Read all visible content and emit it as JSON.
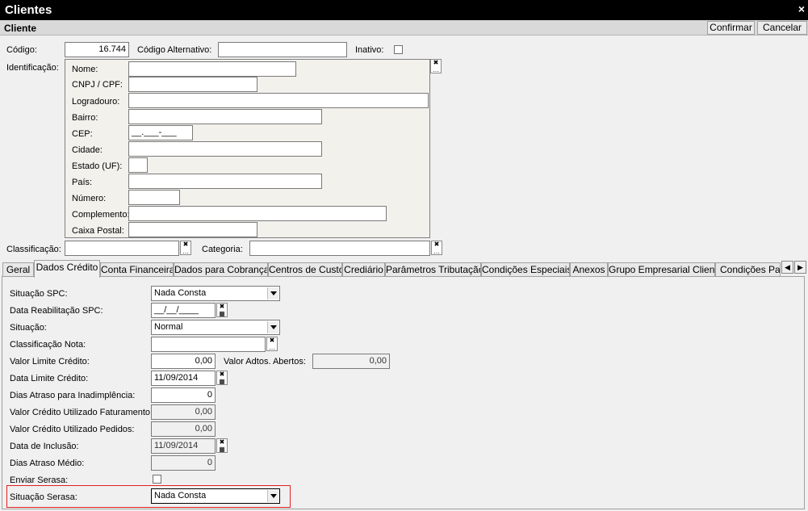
{
  "window": {
    "title": "Clientes",
    "close": "×"
  },
  "header": {
    "title": "Cliente",
    "confirm": "Confirmar",
    "cancel": "Cancelar"
  },
  "top": {
    "codigo_label": "Código:",
    "codigo_value": "16.744",
    "codigo_alt_label": "Código Alternativo:",
    "codigo_alt_value": "",
    "inativo_label": "Inativo:",
    "identificacao_label": "Identificação:"
  },
  "ident": {
    "nome": "Nome:",
    "cnpj": "CNPJ / CPF:",
    "logradouro": "Logradouro:",
    "bairro": "Bairro:",
    "cep": "CEP:",
    "cep_mask": "__.___-___",
    "cidade": "Cidade:",
    "estado": "Estado (UF):",
    "pais": "País:",
    "numero": "Número:",
    "complemento": "Complemento:",
    "caixa_postal": "Caixa Postal:"
  },
  "classificacao_label": "Classificação:",
  "categoria_label": "Categoria:",
  "tabs": [
    "Geral",
    "Dados Crédito",
    "Conta Financeira",
    "Dados para Cobrança",
    "Centros de Custo",
    "Crediário",
    "Parâmetros Tributação",
    "Condições Especiais",
    "Anexos",
    "Grupo Empresarial Cliente",
    "Condições Parc"
  ],
  "credito": {
    "situacao_spc_label": "Situação SPC:",
    "situacao_spc_value": "Nada Consta",
    "data_reab_label": "Data Reabilitação SPC:",
    "data_reab_value": "__/__/____",
    "situacao_label": "Situação:",
    "situacao_value": "Normal",
    "class_nota_label": "Classificação Nota:",
    "valor_limite_label": "Valor Limite Crédito:",
    "valor_limite_value": "0,00",
    "valor_adtos_label": "Valor Adtos. Abertos:",
    "valor_adtos_value": "0,00",
    "data_limite_label": "Data Limite Crédito:",
    "data_limite_value": "11/09/2014",
    "dias_atraso_inad_label": "Dias Atraso para Inadimplência:",
    "dias_atraso_inad_value": "0",
    "valor_fat_label": "Valor Crédito Utilizado Faturamento:",
    "valor_fat_value": "0,00",
    "valor_ped_label": "Valor Crédito Utilizado Pedidos:",
    "valor_ped_value": "0,00",
    "data_inclusao_label": "Data de Inclusão:",
    "data_inclusao_value": "11/09/2014",
    "dias_atraso_medio_label": "Dias Atraso Médio:",
    "dias_atraso_medio_value": "0",
    "enviar_serasa_label": "Enviar Serasa:",
    "situacao_serasa_label": "Situação Serasa:",
    "situacao_serasa_value": "Nada Consta"
  }
}
